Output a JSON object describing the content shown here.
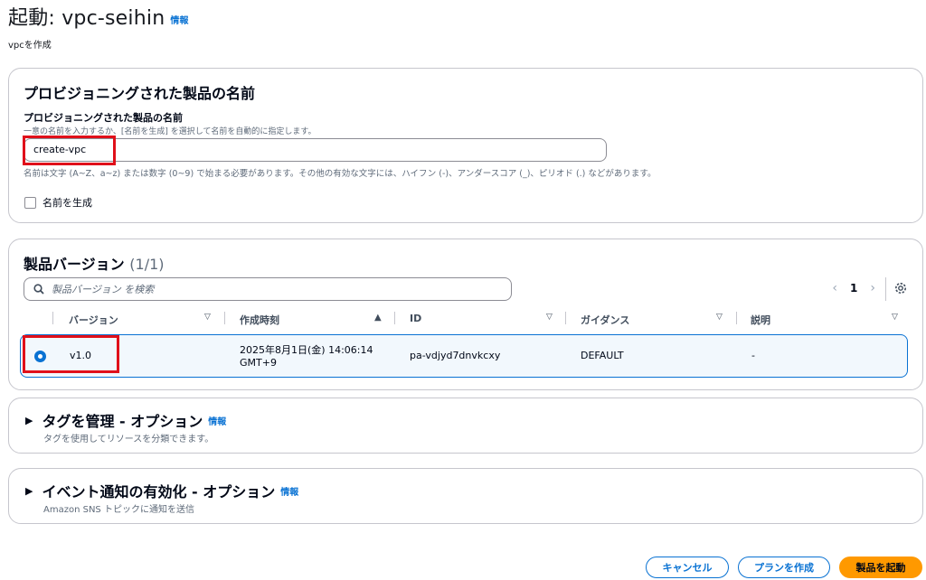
{
  "header": {
    "title": "起動: vpc-seihin",
    "info": "情報",
    "subtitle": "vpcを作成"
  },
  "name_panel": {
    "heading": "プロビジョニングされた製品の名前",
    "field_label": "プロビジョニングされた製品の名前",
    "field_desc": "一意の名前を入力するか、[名前を生成] を選択して名前を自動的に指定します。",
    "value": "create-vpc",
    "constraint": "名前は文字 (A~Z、a~z) または数字 (0~9) で始まる必要があります。その他の有効な文字には、ハイフン (-)、アンダースコア (_)、ピリオド (.) などがあります。",
    "generate_label": "名前を生成",
    "generate_checked": false
  },
  "versions_panel": {
    "heading": "製品バージョン",
    "count": "(1/1)",
    "search_placeholder": "製品バージョン を検索",
    "page": "1",
    "columns": [
      "バージョン",
      "作成時刻",
      "ID",
      "ガイダンス",
      "説明"
    ],
    "rows": [
      {
        "selected": true,
        "version": "v1.0",
        "created_line1": "2025年8月1日(金) 14:06:14",
        "created_line2": "GMT+9",
        "id": "pa-vdjyd7dnvkcxy",
        "guidance": "DEFAULT",
        "description": "-"
      }
    ]
  },
  "tags_panel": {
    "title": "タグを管理 - オプション",
    "info": "情報",
    "desc": "タグを使用してリソースを分類できます。"
  },
  "events_panel": {
    "title": "イベント通知の有効化 - オプション",
    "info": "情報",
    "desc": "Amazon SNS トピックに通知を送信"
  },
  "footer": {
    "cancel": "キャンセル",
    "create_plan": "プランを作成",
    "launch": "製品を起動"
  },
  "colors": {
    "accent": "#0972d3",
    "primary_button": "#ff9900",
    "highlight_box": "#e0101a"
  }
}
